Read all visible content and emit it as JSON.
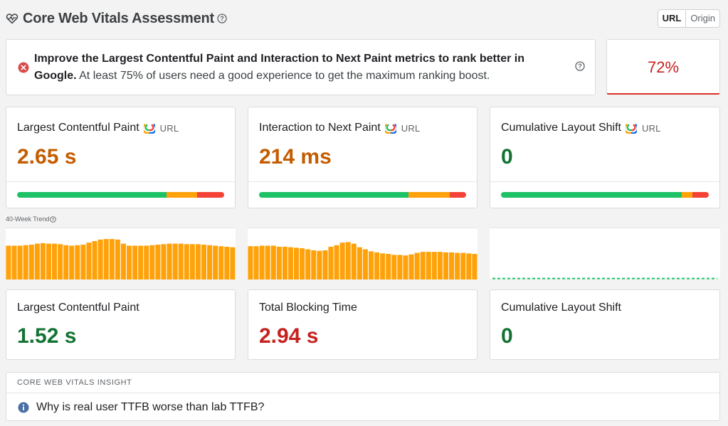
{
  "header": {
    "title": "Core Web Vitals Assessment",
    "toggle": {
      "options": [
        "URL",
        "Origin"
      ],
      "selected": "URL"
    }
  },
  "assessment": {
    "bold_text": "Improve the Largest Contentful Paint and Interaction to Next Paint metrics to rank better in Google.",
    "normal_text": " At least 75% of users need a good experience to get the maximum ranking boost.",
    "score": "72%"
  },
  "field_metrics": [
    {
      "label": "Largest Contentful Paint",
      "source": "URL",
      "value": "2.65 s",
      "status": "needs-improvement",
      "distribution": {
        "good": 0.72,
        "needs_improvement": 0.15,
        "poor": 0.13
      }
    },
    {
      "label": "Interaction to Next Paint",
      "source": "URL",
      "value": "214 ms",
      "status": "needs-improvement",
      "distribution": {
        "good": 0.72,
        "needs_improvement": 0.2,
        "poor": 0.08
      }
    },
    {
      "label": "Cumulative Layout Shift",
      "source": "URL",
      "value": "0",
      "status": "good",
      "distribution": {
        "good": 0.87,
        "needs_improvement": 0.05,
        "poor": 0.08
      }
    }
  ],
  "trend": {
    "label": "40-Week Trend",
    "series": [
      [
        0.66,
        0.66,
        0.66,
        0.67,
        0.68,
        0.7,
        0.71,
        0.7,
        0.7,
        0.69,
        0.67,
        0.66,
        0.67,
        0.68,
        0.72,
        0.75,
        0.78,
        0.79,
        0.79,
        0.78,
        0.7,
        0.66,
        0.66,
        0.66,
        0.66,
        0.67,
        0.68,
        0.69,
        0.7,
        0.7,
        0.7,
        0.69,
        0.69,
        0.69,
        0.68,
        0.67,
        0.66,
        0.65,
        0.64,
        0.63
      ],
      [
        0.65,
        0.65,
        0.66,
        0.66,
        0.66,
        0.64,
        0.64,
        0.63,
        0.62,
        0.61,
        0.59,
        0.57,
        0.56,
        0.57,
        0.64,
        0.67,
        0.72,
        0.73,
        0.7,
        0.63,
        0.59,
        0.55,
        0.53,
        0.51,
        0.5,
        0.48,
        0.48,
        0.47,
        0.49,
        0.52,
        0.54,
        0.54,
        0.54,
        0.54,
        0.53,
        0.53,
        0.52,
        0.52,
        0.51,
        0.5
      ],
      [
        0.02,
        0.02,
        0.02,
        0.02,
        0.02,
        0.02,
        0.02,
        0.02,
        0.02,
        0.02,
        0.02,
        0.02,
        0.02,
        0.02,
        0.02,
        0.02,
        0.02,
        0.02,
        0.02,
        0.02,
        0.02,
        0.02,
        0.02,
        0.02,
        0.02,
        0.02,
        0.02,
        0.02,
        0.02,
        0.02,
        0.02,
        0.02,
        0.02,
        0.02,
        0.02,
        0.02,
        0.02,
        0.02,
        0.02,
        0.02
      ]
    ],
    "colors": {
      "bar": "#ffa20a",
      "good_line": "#1ec266"
    }
  },
  "lab_metrics": [
    {
      "label": "Largest Contentful Paint",
      "value": "1.52 s",
      "status": "good"
    },
    {
      "label": "Total Blocking Time",
      "value": "2.94 s",
      "status": "poor"
    },
    {
      "label": "Cumulative Layout Shift",
      "value": "0",
      "status": "good"
    }
  ],
  "insight": {
    "title": "CORE WEB VITALS INSIGHT",
    "question": "Why is real user TTFB worse than lab TTFB?"
  },
  "colors": {
    "good": "#137333",
    "needs_improvement": "#c35d00",
    "poor": "#c5221f"
  },
  "icons": [
    "heart-pulse-icon",
    "help-icon",
    "fail-icon",
    "crux-icon",
    "info-icon"
  ]
}
